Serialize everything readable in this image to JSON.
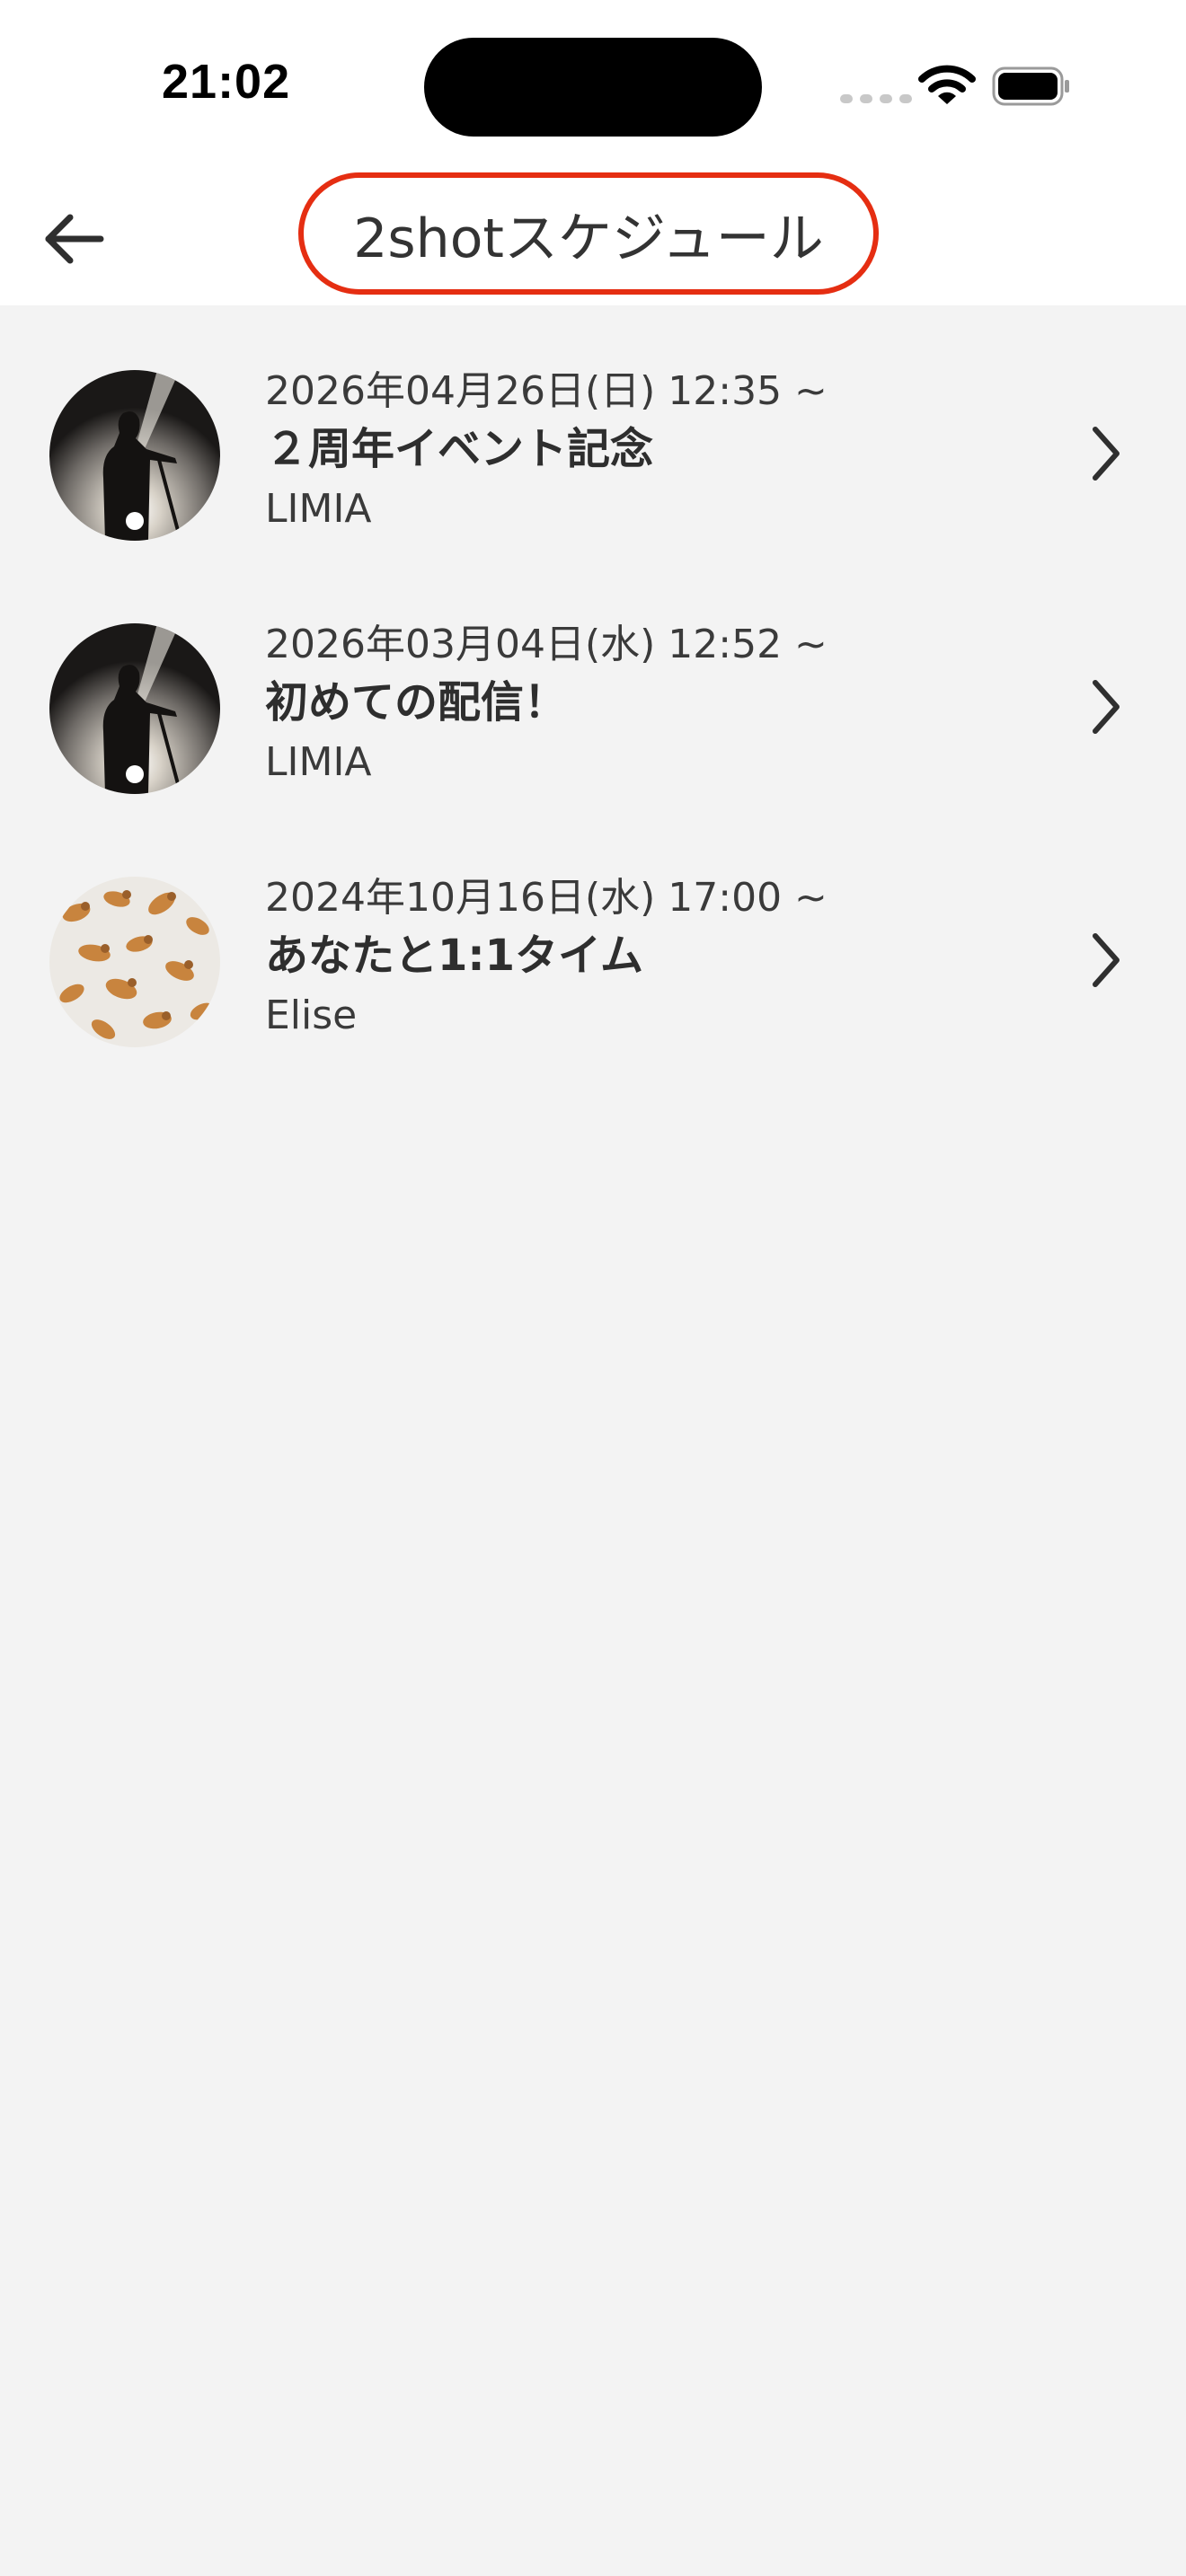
{
  "status_bar": {
    "time": "21:02",
    "icons": [
      "cellular-signal-icon",
      "wifi-icon",
      "battery-icon"
    ]
  },
  "header": {
    "title": "2shotスケジュール",
    "back_icon": "arrow-left-icon",
    "highlight_color": "#e52e12"
  },
  "events": [
    {
      "date": "2026年04月26日(日) 12:35 ~",
      "title": "２周年イベント記念",
      "host": "LIMIA",
      "avatar": "concert-silhouette"
    },
    {
      "date": "2026年03月04日(水) 12:52 ~",
      "title": "初めての配信！",
      "host": "LIMIA",
      "avatar": "concert-silhouette"
    },
    {
      "date": "2024年10月16日(水) 17:00 ~",
      "title": "あなたと1:1タイム",
      "host": "Elise",
      "avatar": "dinosaur-cookies"
    }
  ],
  "colors": {
    "background": "#f3f3f3",
    "text": "#2f2f2f"
  }
}
